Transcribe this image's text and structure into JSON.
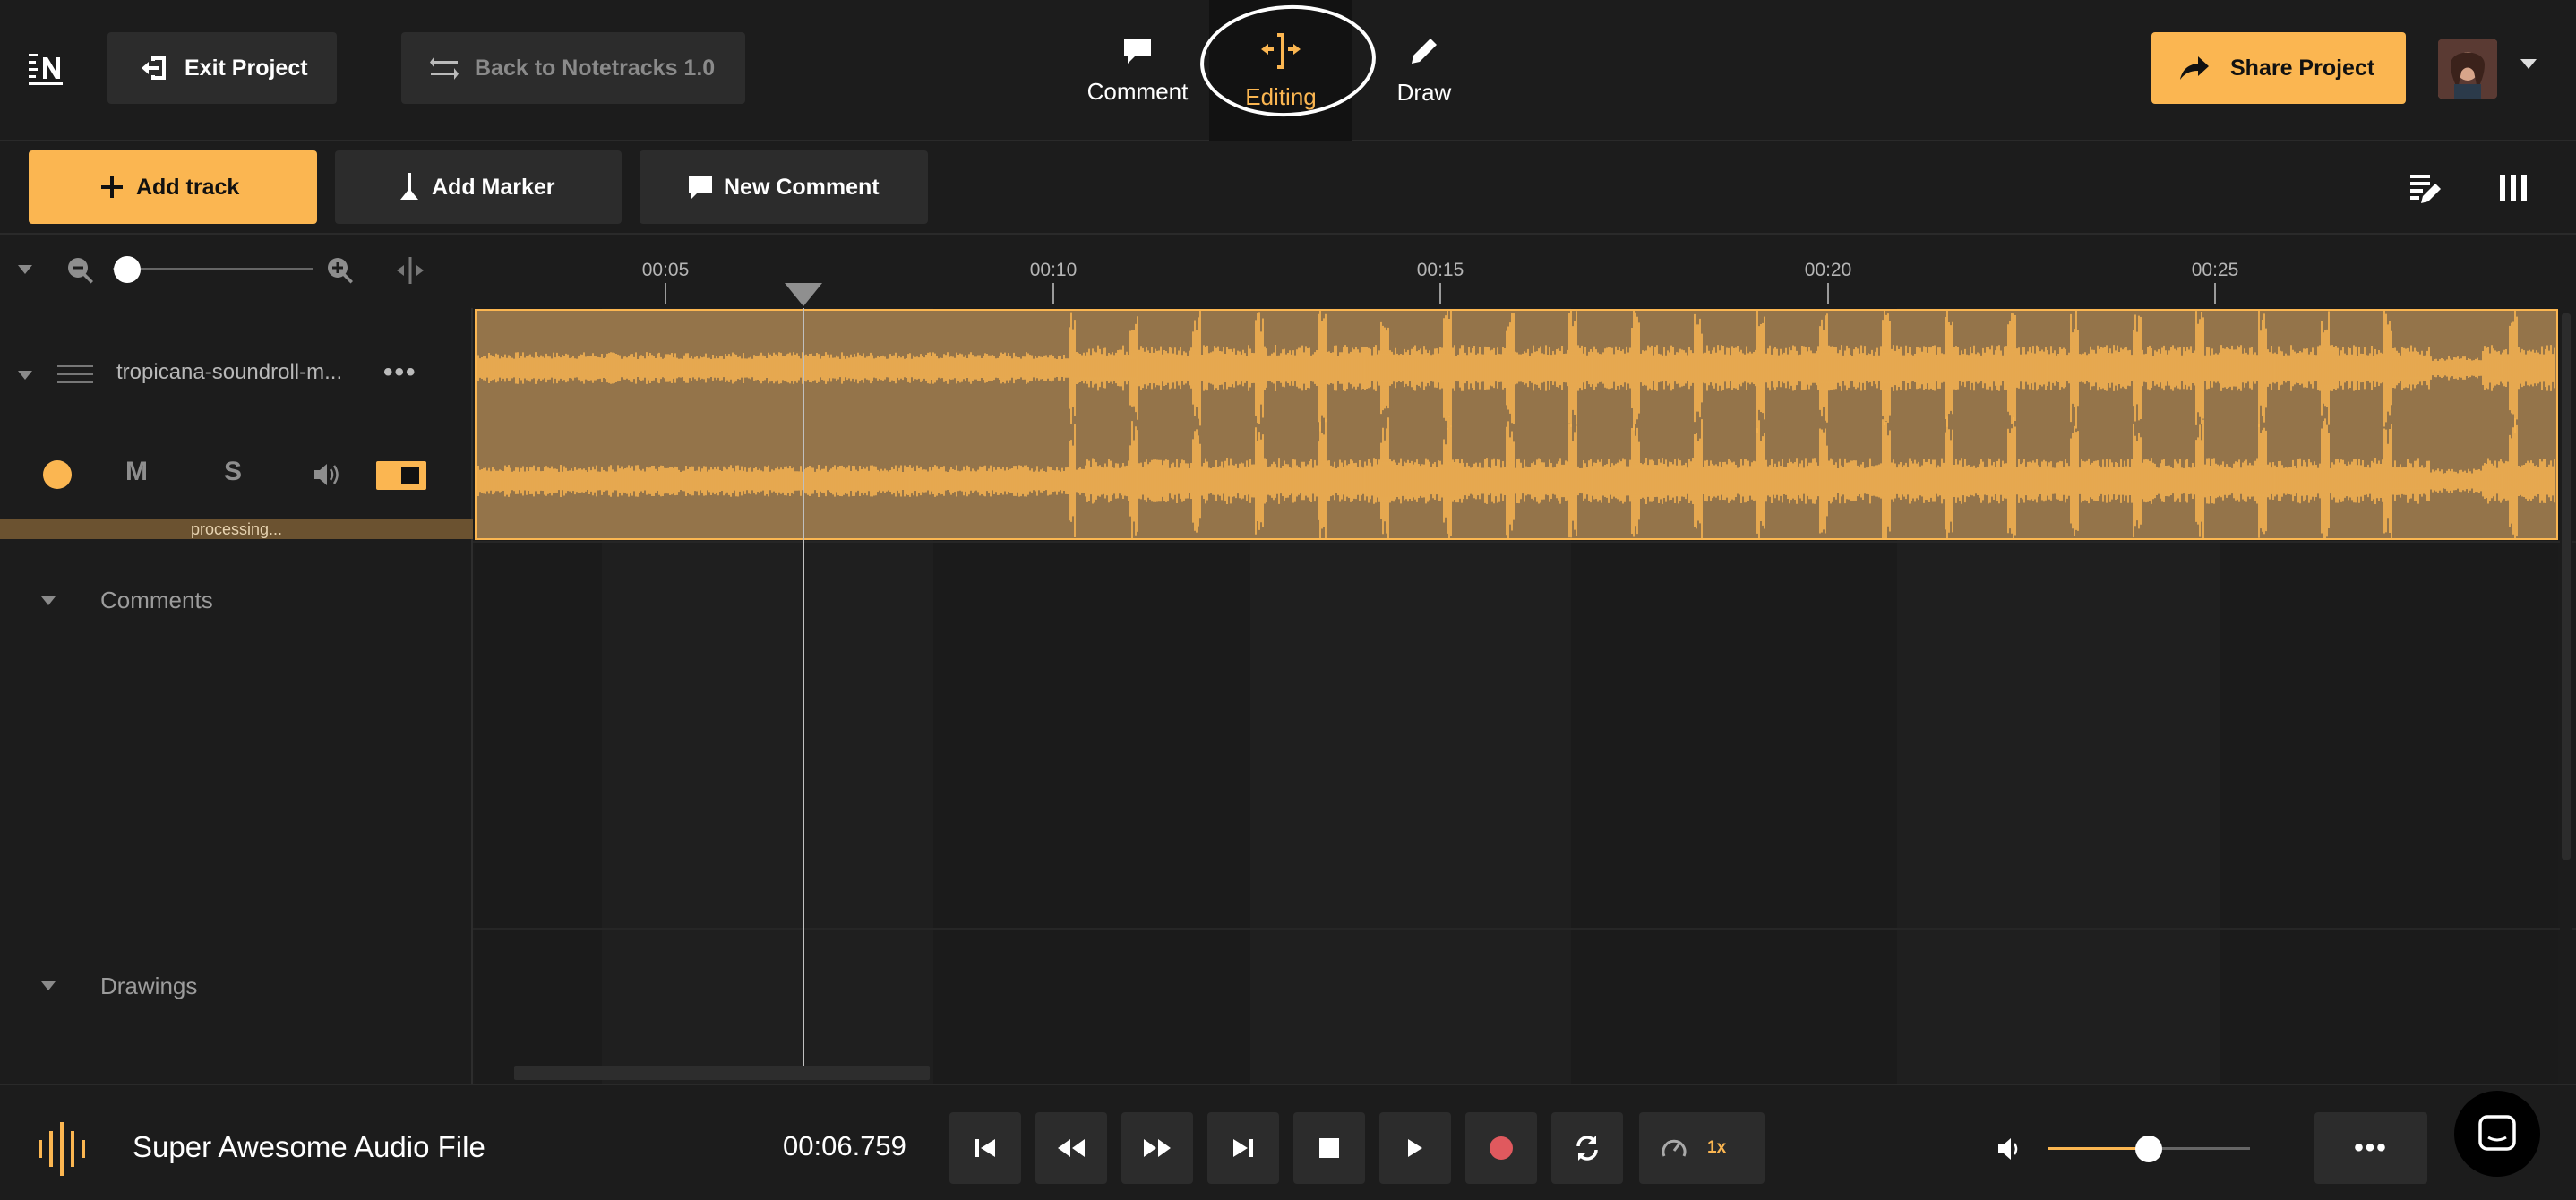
{
  "topbar": {
    "exit_label": "Exit Project",
    "back_label": "Back to Notetracks 1.0",
    "modes": [
      {
        "label": "Comment",
        "icon": "comment-bubble-icon"
      },
      {
        "label": "Editing",
        "icon": "editing-bracket-icon",
        "active": true
      },
      {
        "label": "Draw",
        "icon": "pencil-icon"
      }
    ],
    "share_label": "Share Project"
  },
  "toolbar": {
    "add_track_label": "Add track",
    "add_marker_label": "Add Marker",
    "new_comment_label": "New Comment"
  },
  "ruler": {
    "ticks": [
      "00:05",
      "00:10",
      "00:15",
      "00:20",
      "00:25"
    ]
  },
  "zoom": {
    "level": 0.0
  },
  "track": {
    "name": "tropicana-soundroll-m...",
    "more_label": "•••",
    "mute_label": "M",
    "solo_label": "S",
    "status": "processing..."
  },
  "sections": {
    "comments_label": "Comments",
    "drawings_label": "Drawings"
  },
  "transport": {
    "file_name": "Super Awesome Audio File",
    "time": "00:06.759",
    "speed_label": "1x",
    "more_label": "•••",
    "volume": 0.5
  },
  "colors": {
    "accent": "#fbb651",
    "background": "#1c1c1c",
    "button": "#2c2c2c",
    "record": "#e0595e",
    "waveform_bg": "#94744a"
  }
}
